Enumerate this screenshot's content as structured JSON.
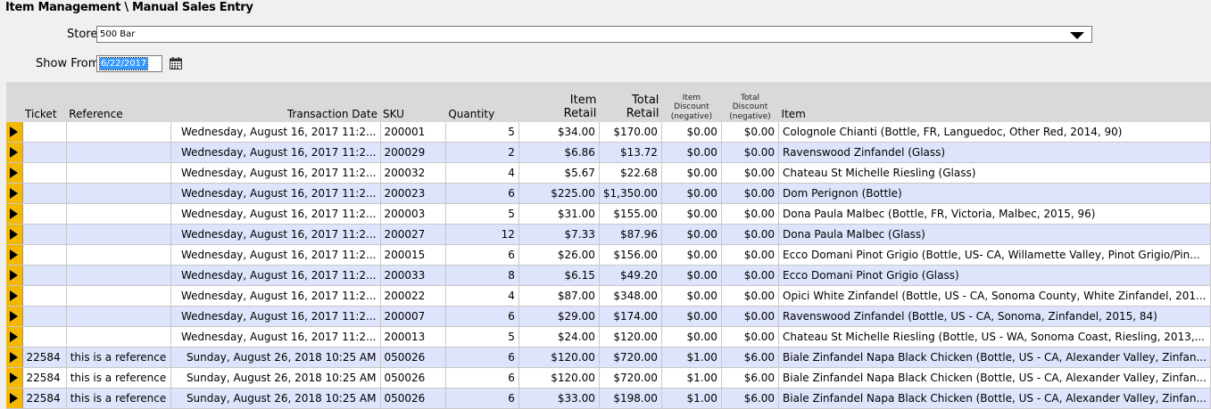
{
  "header": {
    "title": "Item Management \\ Manual Sales Entry"
  },
  "filters": {
    "store_label": "Store",
    "store_value": "500 Bar",
    "show_from_label": "Show From",
    "show_from_value": "6/22/2017"
  },
  "columns": {
    "ticket": "Ticket",
    "reference": "Reference",
    "transaction_date": "Transaction Date",
    "sku": "SKU",
    "quantity": "Quantity",
    "item_retail_1": "Item",
    "item_retail_2": "Retail",
    "total_retail_1": "Total",
    "total_retail_2": "Retail",
    "item_discount_1": "Item",
    "item_discount_2": "Discount",
    "item_discount_3": "(negative)",
    "total_discount_1": "Total",
    "total_discount_2": "Discount",
    "total_discount_3": "(negative)",
    "item": "Item"
  },
  "rows": [
    {
      "ticket": "",
      "reference": "",
      "date": "Wednesday, August 16, 2017 11:2...",
      "sku": "200001",
      "qty": "5",
      "item_retail": "$34.00",
      "total_retail": "$170.00",
      "item_discount": "$0.00",
      "total_discount": "$0.00",
      "item": "Colognole Chianti (Bottle, FR, Languedoc, Other Red, 2014, 90)"
    },
    {
      "ticket": "",
      "reference": "",
      "date": "Wednesday, August 16, 2017 11:2...",
      "sku": "200029",
      "qty": "2",
      "item_retail": "$6.86",
      "total_retail": "$13.72",
      "item_discount": "$0.00",
      "total_discount": "$0.00",
      "item": "Ravenswood Zinfandel (Glass)"
    },
    {
      "ticket": "",
      "reference": "",
      "date": "Wednesday, August 16, 2017 11:2...",
      "sku": "200032",
      "qty": "4",
      "item_retail": "$5.67",
      "total_retail": "$22.68",
      "item_discount": "$0.00",
      "total_discount": "$0.00",
      "item": "Chateau St Michelle Riesling (Glass)"
    },
    {
      "ticket": "",
      "reference": "",
      "date": "Wednesday, August 16, 2017 11:2...",
      "sku": "200023",
      "qty": "6",
      "item_retail": "$225.00",
      "total_retail": "$1,350.00",
      "item_discount": "$0.00",
      "total_discount": "$0.00",
      "item": "Dom Perignon (Bottle)"
    },
    {
      "ticket": "",
      "reference": "",
      "date": "Wednesday, August 16, 2017 11:2...",
      "sku": "200003",
      "qty": "5",
      "item_retail": "$31.00",
      "total_retail": "$155.00",
      "item_discount": "$0.00",
      "total_discount": "$0.00",
      "item": "Dona Paula Malbec (Bottle, FR, Victoria, Malbec, 2015, 96)"
    },
    {
      "ticket": "",
      "reference": "",
      "date": "Wednesday, August 16, 2017 11:2...",
      "sku": "200027",
      "qty": "12",
      "item_retail": "$7.33",
      "total_retail": "$87.96",
      "item_discount": "$0.00",
      "total_discount": "$0.00",
      "item": "Dona Paula Malbec (Glass)"
    },
    {
      "ticket": "",
      "reference": "",
      "date": "Wednesday, August 16, 2017 11:2...",
      "sku": "200015",
      "qty": "6",
      "item_retail": "$26.00",
      "total_retail": "$156.00",
      "item_discount": "$0.00",
      "total_discount": "$0.00",
      "item": "Ecco Domani Pinot Grigio (Bottle, US- CA, Willamette Valley, Pinot Grigio/Pin..."
    },
    {
      "ticket": "",
      "reference": "",
      "date": "Wednesday, August 16, 2017 11:2...",
      "sku": "200033",
      "qty": "8",
      "item_retail": "$6.15",
      "total_retail": "$49.20",
      "item_discount": "$0.00",
      "total_discount": "$0.00",
      "item": "Ecco Domani Pinot Grigio (Glass)"
    },
    {
      "ticket": "",
      "reference": "",
      "date": "Wednesday, August 16, 2017 11:2...",
      "sku": "200022",
      "qty": "4",
      "item_retail": "$87.00",
      "total_retail": "$348.00",
      "item_discount": "$0.00",
      "total_discount": "$0.00",
      "item": "Opici White Zinfandel (Bottle, US - CA, Sonoma County, White Zinfandel, 201..."
    },
    {
      "ticket": "",
      "reference": "",
      "date": "Wednesday, August 16, 2017 11:2...",
      "sku": "200007",
      "qty": "6",
      "item_retail": "$29.00",
      "total_retail": "$174.00",
      "item_discount": "$0.00",
      "total_discount": "$0.00",
      "item": "Ravenswood Zinfandel (Bottle, US - CA, Sonoma, Zinfandel, 2015, 84)"
    },
    {
      "ticket": "",
      "reference": "",
      "date": "Wednesday, August 16, 2017 11:2...",
      "sku": "200013",
      "qty": "5",
      "item_retail": "$24.00",
      "total_retail": "$120.00",
      "item_discount": "$0.00",
      "total_discount": "$0.00",
      "item": "Chateau St Michelle Riesling (Bottle, US - WA, Sonoma Coast, Riesling, 2013,..."
    },
    {
      "ticket": "22584",
      "reference": "this is a reference",
      "date": "Sunday, August 26, 2018 10:25 AM",
      "sku": "050026",
      "qty": "6",
      "item_retail": "$120.00",
      "total_retail": "$720.00",
      "item_discount": "$1.00",
      "total_discount": "$6.00",
      "item": "Biale Zinfandel Napa Black Chicken (Bottle, US - CA, Alexander Valley, Zinfan..."
    },
    {
      "ticket": "22584",
      "reference": "this is a reference",
      "date": "Sunday, August 26, 2018 10:25 AM",
      "sku": "050026",
      "qty": "6",
      "item_retail": "$120.00",
      "total_retail": "$720.00",
      "item_discount": "$1.00",
      "total_discount": "$6.00",
      "item": "Biale Zinfandel Napa Black Chicken (Bottle, US - CA, Alexander Valley, Zinfan..."
    },
    {
      "ticket": "22584",
      "reference": "this is a reference",
      "date": "Sunday, August 26, 2018 10:25 AM",
      "sku": "050026",
      "qty": "6",
      "item_retail": "$33.00",
      "total_retail": "$198.00",
      "item_discount": "$1.00",
      "total_discount": "$6.00",
      "item": "Biale Zinfandel Napa Black Chicken (Bottle, US - CA, Alexander Valley, Zinfan..."
    }
  ]
}
